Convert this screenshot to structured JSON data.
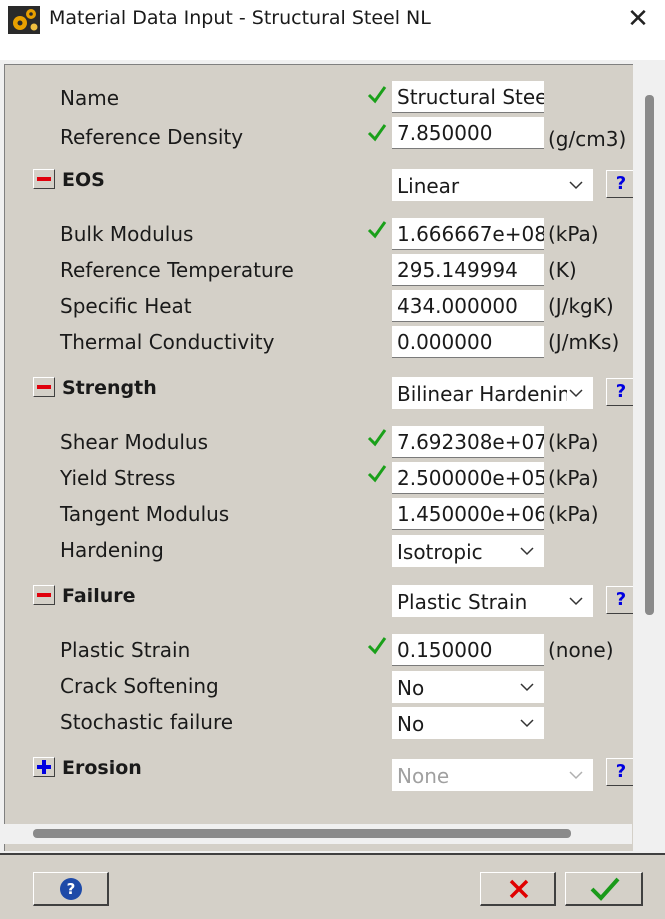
{
  "window": {
    "title": "Material Data Input - Structural Steel NL",
    "close_glyph": "✕"
  },
  "fields": [
    {
      "label": "Name",
      "value": "Structural Steel NL",
      "unit": "",
      "checked": true
    },
    {
      "label": "Reference Density",
      "value": "7.850000",
      "unit": "(g/cm3)",
      "checked": true
    }
  ],
  "sections": {
    "eos": {
      "label": "EOS",
      "selected": "Linear",
      "help": "?",
      "fields": [
        {
          "label": "Bulk Modulus",
          "value": "1.666667e+08",
          "unit": "(kPa)",
          "checked": true
        },
        {
          "label": "Reference Temperature",
          "value": "295.149994",
          "unit": "(K)",
          "checked": false
        },
        {
          "label": "Specific Heat",
          "value": "434.000000",
          "unit": "(J/kgK)",
          "checked": false
        },
        {
          "label": "Thermal Conductivity",
          "value": "0.000000",
          "unit": "(J/mKs)",
          "checked": false
        }
      ]
    },
    "strength": {
      "label": "Strength",
      "selected": "Bilinear Hardening",
      "help": "?",
      "fields": [
        {
          "label": "Shear Modulus",
          "value": "7.692308e+07",
          "unit": "(kPa)",
          "checked": true
        },
        {
          "label": "Yield Stress",
          "value": "2.500000e+05",
          "unit": "(kPa)",
          "checked": true
        },
        {
          "label": "Tangent Modulus",
          "value": "1.450000e+06",
          "unit": "(kPa)",
          "checked": false
        }
      ],
      "hardening": {
        "label": "Hardening",
        "selected": "Isotropic"
      }
    },
    "failure": {
      "label": "Failure",
      "selected": "Plastic Strain",
      "help": "?",
      "fields": [
        {
          "label": "Plastic Strain",
          "value": "0.150000",
          "unit": "(none)",
          "checked": true
        }
      ],
      "crack_softening": {
        "label": "Crack Softening",
        "selected": "No"
      },
      "stochastic_failure": {
        "label": "Stochastic failure",
        "selected": "No"
      }
    },
    "erosion": {
      "label": "Erosion",
      "selected": "None",
      "help": "?"
    }
  },
  "footer": {
    "help_label": "?"
  },
  "colors": {
    "panel": "#d4d0c8",
    "check": "#1aa01a",
    "minus": "#e0000c",
    "plus": "#0000e0",
    "cancel": "#e00000",
    "ok": "#1a9a1a"
  }
}
